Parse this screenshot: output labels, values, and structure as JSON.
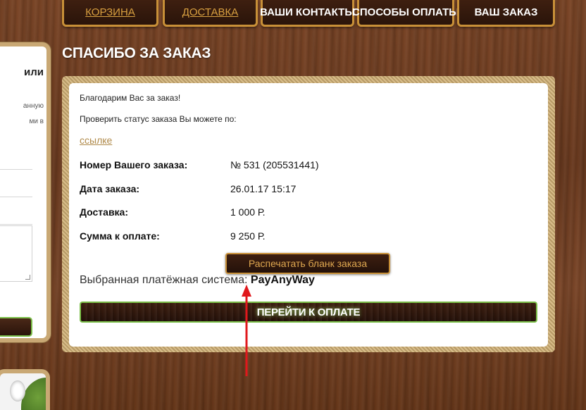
{
  "nav": {
    "items": [
      {
        "label": "КОРЗИНА"
      },
      {
        "label": "ДОСТАВКА"
      },
      {
        "label": "ВАШИ КОНТАКТЫ"
      },
      {
        "label": "СПОСОБЫ ОПЛАТЫ"
      },
      {
        "label": "ВАШ ЗАКАЗ"
      }
    ]
  },
  "sidebar": {
    "heading_fragment": "или",
    "text_fragment_1": "анную",
    "text_fragment_2": "ми в"
  },
  "page": {
    "title": "СПАСИБО ЗА ЗАКАЗ"
  },
  "order": {
    "thanks": "Благодарим Вас за заказ!",
    "check_status": "Проверить статус заказа Вы можете по:",
    "status_link": "ссылке",
    "rows": [
      {
        "label": "Номер Вашего заказа:",
        "value": "№ 531 (205531441)"
      },
      {
        "label": "Дата заказа:",
        "value": "26.01.17 15:17"
      },
      {
        "label": "Доставка:",
        "value": "1 000 Р."
      },
      {
        "label": "Сумма к оплате:",
        "value": "9 250 Р."
      }
    ],
    "print_button": "Распечатать бланк заказа",
    "payment_system_label": "Выбранная платёжная система:",
    "payment_system_name": "PayAnyWay",
    "pay_button": "ПЕРЕЙТИ К ОПЛАТЕ"
  },
  "colors": {
    "accent_gold": "#c89038",
    "accent_green": "#7cc04a",
    "annotation_red": "#e0181c",
    "wood": "#6a3a1f"
  }
}
